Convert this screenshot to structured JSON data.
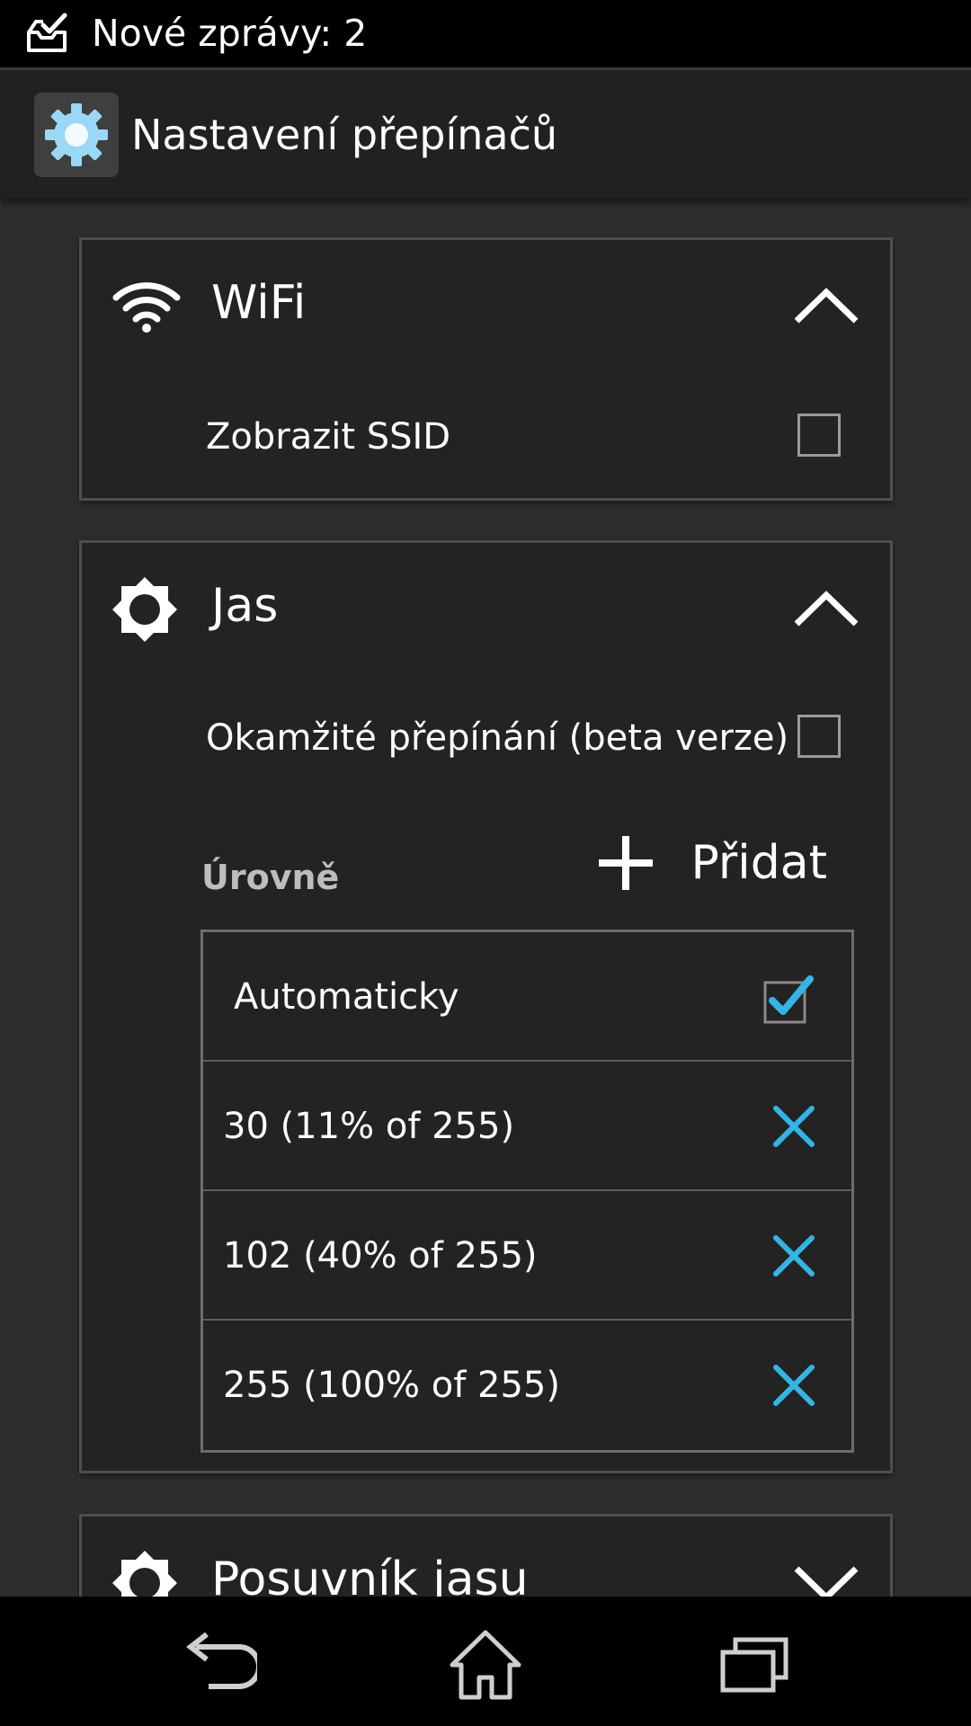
{
  "status_bar": {
    "notification_icon": "inbox-check-icon",
    "text": "Nové zprávy: 2"
  },
  "action_bar": {
    "app_icon": "gear-icon",
    "title": "Nastavení přepínačů"
  },
  "wifi_card": {
    "icon": "wifi-icon",
    "title": "WiFi",
    "expanded": true,
    "show_ssid_label": "Zobrazit SSID",
    "show_ssid_checked": false
  },
  "brightness_card": {
    "icon": "brightness-icon",
    "title": "Jas",
    "expanded": true,
    "instant_switch_label": "Okamžité přepínání (beta verze)",
    "instant_switch_checked": false,
    "levels_title": "Úrovně",
    "add_label": "Přidat",
    "levels": [
      {
        "label": "Automaticky",
        "type": "auto",
        "checked": true
      },
      {
        "label": "30 (11% of 255)",
        "type": "value"
      },
      {
        "label": "102 (40% of 255)",
        "type": "value"
      },
      {
        "label": "255 (100% of 255)",
        "type": "value"
      }
    ]
  },
  "slider_card": {
    "icon": "brightness-icon",
    "title": "Posuvník jasu",
    "expanded": false
  },
  "nav_bar": {
    "buttons": [
      "back-icon",
      "home-icon",
      "recents-icon"
    ]
  },
  "colors": {
    "accent": "#33b5e5",
    "background": "#2d2d2d",
    "card": "#232323"
  }
}
